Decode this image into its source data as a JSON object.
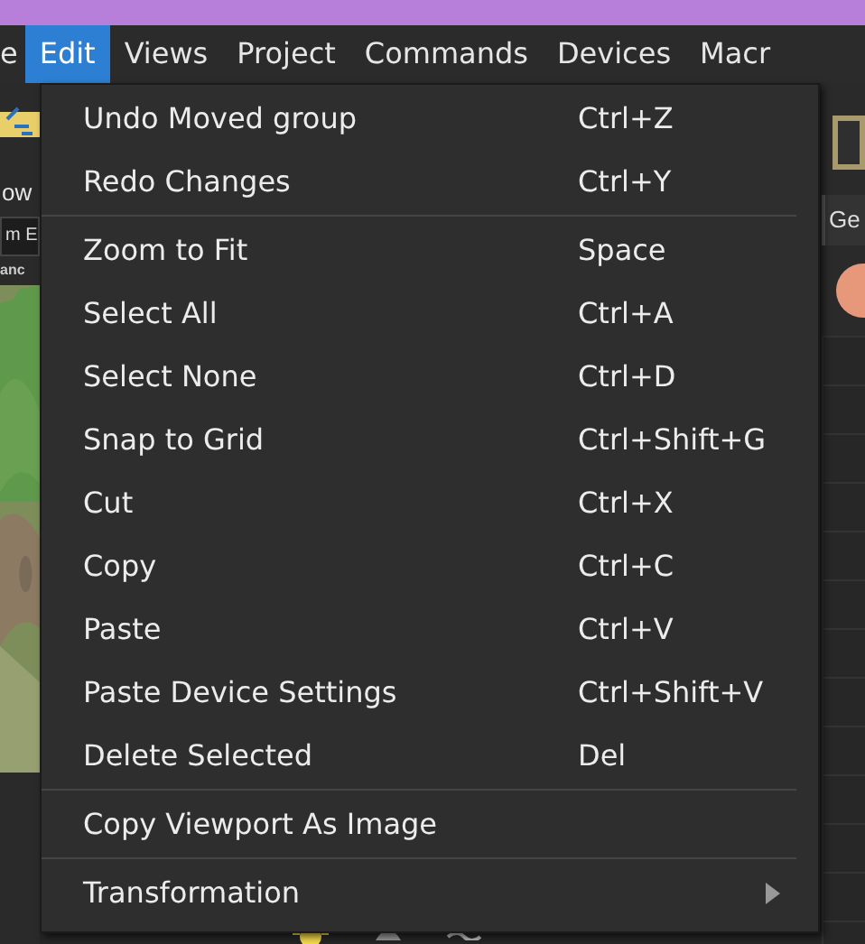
{
  "menubar": [
    {
      "label": "e",
      "selected": false
    },
    {
      "label": "Edit",
      "selected": true
    },
    {
      "label": "Views",
      "selected": false
    },
    {
      "label": "Project",
      "selected": false
    },
    {
      "label": "Commands",
      "selected": false
    },
    {
      "label": "Devices",
      "selected": false
    },
    {
      "label": "Macr",
      "selected": false
    }
  ],
  "left_panel": {
    "title": "ow",
    "field": "m E",
    "label": "anc",
    "kind": "picture"
  },
  "right_panel": {
    "tab": "Ge"
  },
  "menu": {
    "groups": [
      [
        {
          "label": "Undo Moved group",
          "shortcut": "Ctrl+Z"
        },
        {
          "label": "Redo Changes",
          "shortcut": "Ctrl+Y"
        }
      ],
      [
        {
          "label": "Zoom to Fit",
          "shortcut": "Space"
        },
        {
          "label": "Select All",
          "shortcut": "Ctrl+A"
        },
        {
          "label": "Select None",
          "shortcut": "Ctrl+D"
        },
        {
          "label": "Snap to Grid",
          "shortcut": "Ctrl+Shift+G"
        },
        {
          "label": "Cut",
          "shortcut": "Ctrl+X"
        },
        {
          "label": "Copy",
          "shortcut": "Ctrl+C"
        },
        {
          "label": "Paste",
          "shortcut": "Ctrl+V"
        },
        {
          "label": "Paste Device Settings",
          "shortcut": "Ctrl+Shift+V"
        },
        {
          "label": "Delete Selected",
          "shortcut": "Del"
        }
      ],
      [
        {
          "label": "Copy Viewport As Image"
        }
      ],
      [
        {
          "label": "Transformation",
          "submenu": true
        }
      ]
    ]
  }
}
